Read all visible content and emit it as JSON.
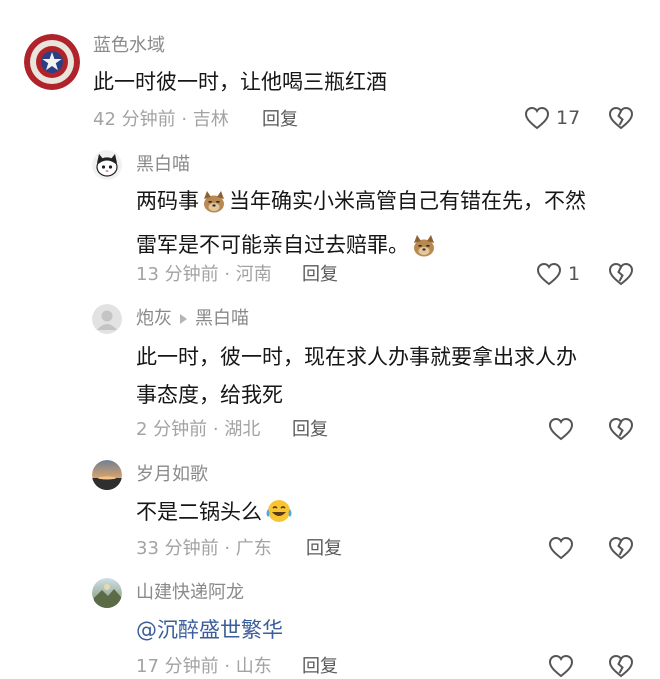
{
  "comments": [
    {
      "username": "蓝色水域",
      "text": "此一时彼一时，让他喝三瓶红酒",
      "time_location": "42 分钟前 · 吉林",
      "reply_label": "回复",
      "like_count": "17",
      "avatar_icon": "captain-america-shield-avatar"
    },
    {
      "username": "黑白喵",
      "text_line1_a": "两码事",
      "text_line1_b": "当年确实小米高管自己有错在先，不然",
      "text_line2_a": "雷军是不可能亲自过去赔罪。",
      "time_location": "13 分钟前 · 河南",
      "reply_label": "回复",
      "like_count": "1",
      "avatar_icon": "black-white-cat-avatar",
      "emoji_icon": "dog-face-emoji"
    },
    {
      "username": "炮灰",
      "reply_to": "黑白喵",
      "text_line1": "此一时，彼一时，现在求人办事就要拿出求人办",
      "text_line2": "事态度，给我死",
      "time_location": "2 分钟前 · 湖北",
      "reply_label": "回复",
      "like_count": "",
      "avatar_icon": "default-gray-avatar"
    },
    {
      "username": "岁月如歌",
      "text": "不是二锅头么",
      "time_location": "33 分钟前 · 广东",
      "reply_label": "回复",
      "like_count": "",
      "avatar_icon": "sunset-landscape-avatar",
      "emoji_icon": "laughing-tears-emoji"
    },
    {
      "username": "山建快递阿龙",
      "text": "@沉醉盛世繁华",
      "time_location": "17 分钟前 · 山东",
      "reply_label": "回复",
      "like_count": "",
      "avatar_icon": "landscape-avatar"
    }
  ],
  "colors": {
    "username": "#8a8a8a",
    "body_text": "#161616",
    "meta_text": "#a3a3a3",
    "mention": "#3b5e9a",
    "icon_stroke": "#555555"
  }
}
